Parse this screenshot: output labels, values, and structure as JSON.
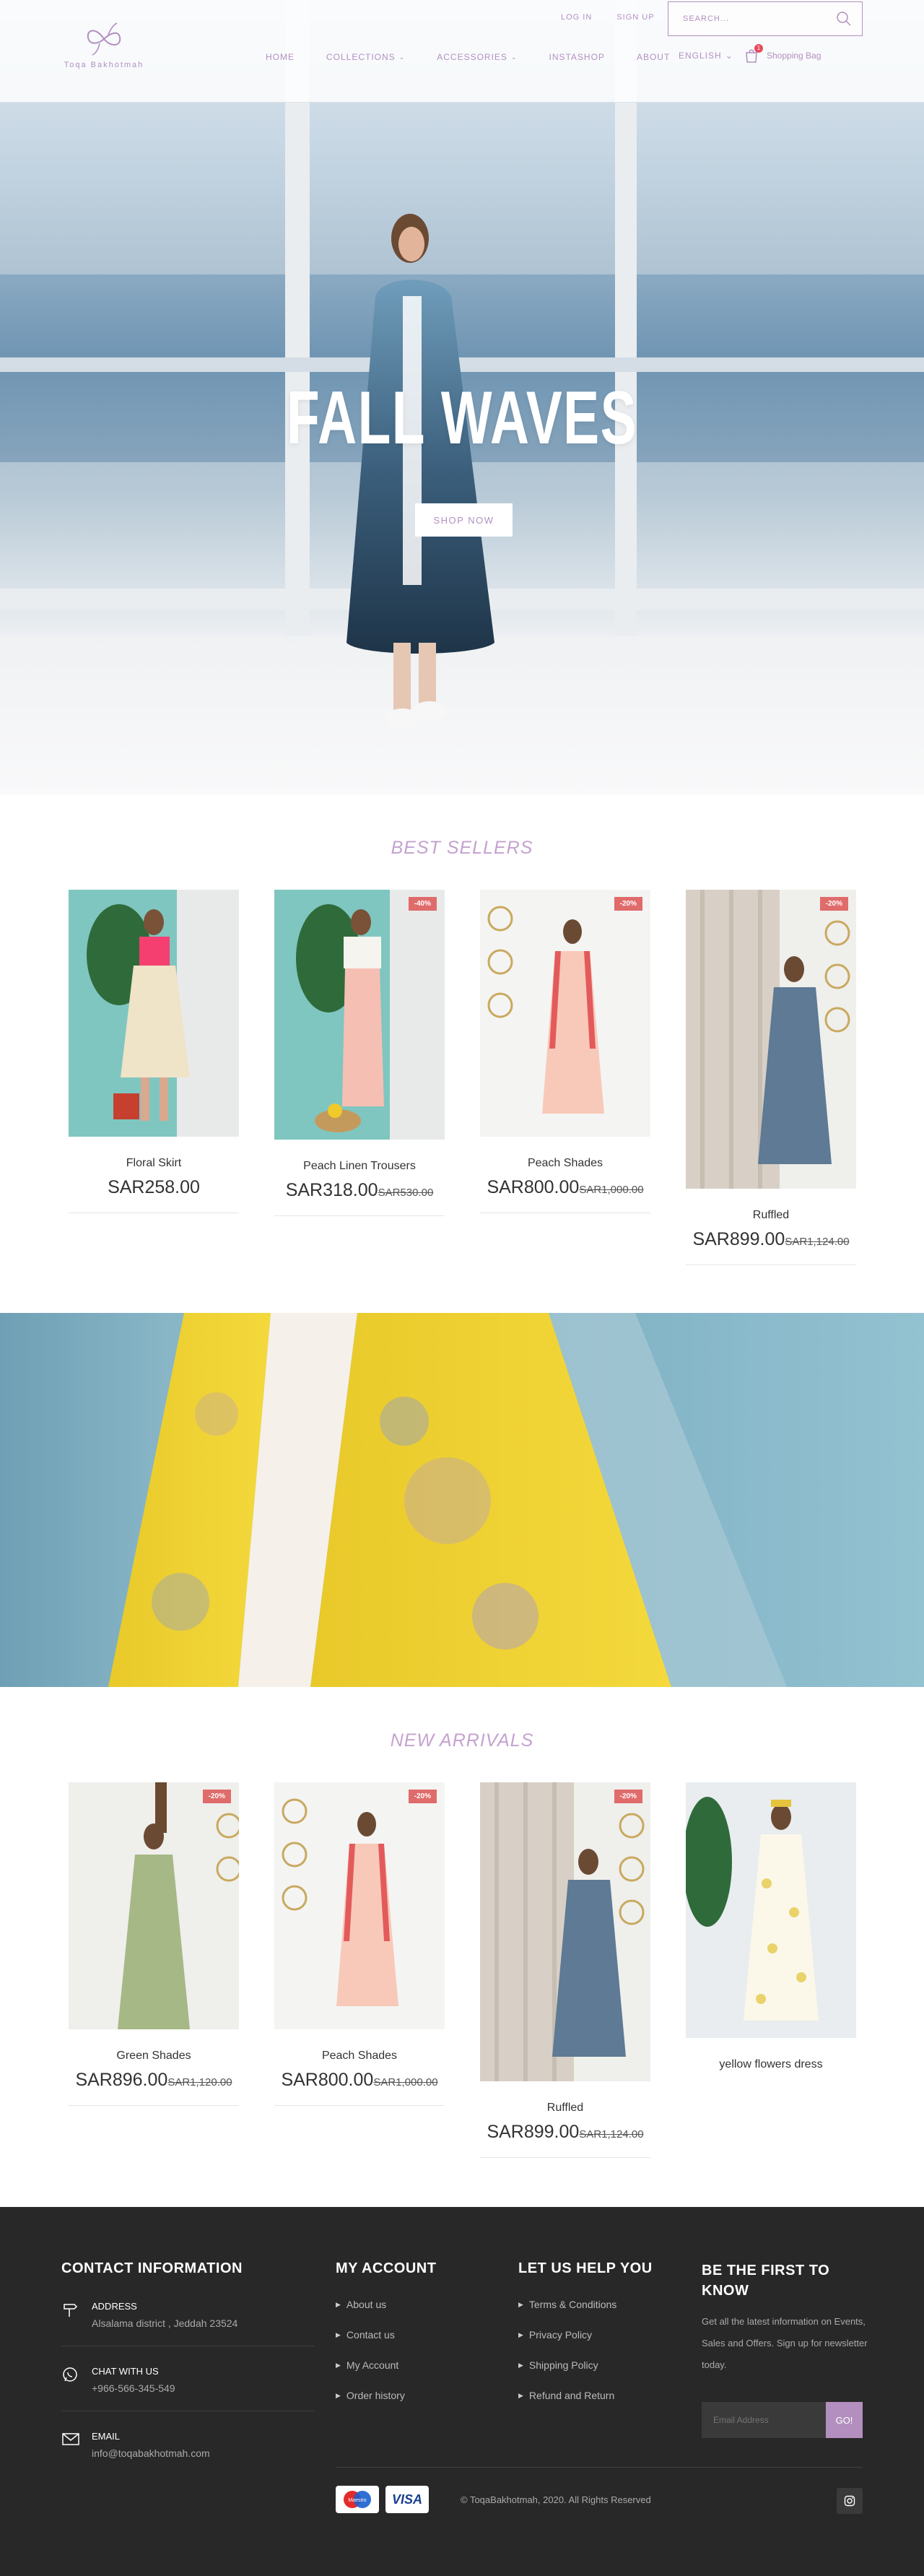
{
  "brand": {
    "name": "Toqa Bakhotmah",
    "accent": "#b38fbf",
    "sale_badge_color": "#e06b6b"
  },
  "header": {
    "login": "LOG IN",
    "signup": "SIGN UP",
    "search_placeholder": "SEARCH...",
    "nav": [
      {
        "label": "HOME",
        "dropdown": false
      },
      {
        "label": "COLLECTIONS",
        "dropdown": true
      },
      {
        "label": "ACCESSORIES",
        "dropdown": true
      },
      {
        "label": "INSTASHOP",
        "dropdown": false
      },
      {
        "label": "ABOUT",
        "dropdown": false
      }
    ],
    "language": "ENGLISH",
    "bag_label": "Shopping Bag",
    "bag_count": "1"
  },
  "hero": {
    "title": "FALL WAVES",
    "button": "SHOP NOW"
  },
  "best_sellers": {
    "title": "BEST SELLERS",
    "products": [
      {
        "name": "Floral Skirt",
        "price": "SAR258.00",
        "old_price": "",
        "badge": ""
      },
      {
        "name": "Peach Linen Trousers",
        "price": "SAR318.00",
        "old_price": "SAR530.00",
        "badge": "-40%"
      },
      {
        "name": "Peach Shades",
        "price": "SAR800.00",
        "old_price": "SAR1,000.00",
        "badge": "-20%"
      },
      {
        "name": "Ruffled",
        "price": "SAR899.00",
        "old_price": "SAR1,124.00",
        "badge": "-20%"
      }
    ]
  },
  "new_arrivals": {
    "title": "NEW ARRIVALS",
    "products": [
      {
        "name": "Green Shades",
        "price": "SAR896.00",
        "old_price": "SAR1,120.00",
        "badge": "-20%"
      },
      {
        "name": "Peach Shades",
        "price": "SAR800.00",
        "old_price": "SAR1,000.00",
        "badge": "-20%"
      },
      {
        "name": "Ruffled",
        "price": "SAR899.00",
        "old_price": "SAR1,124.00",
        "badge": "-20%"
      },
      {
        "name": "yellow flowers dress",
        "price": "",
        "old_price": "",
        "badge": ""
      }
    ]
  },
  "footer": {
    "contact_title": "CONTACT INFORMATION",
    "address_label": "ADDRESS",
    "address_value": "Alsalama district , Jeddah 23524",
    "chat_label": "CHAT WITH US",
    "chat_value": "+966-566-345-549",
    "email_label": "EMAIL",
    "email_value": "info@toqabakhotmah.com",
    "account_title": "MY ACCOUNT",
    "account_links": [
      "About us",
      "Contact us",
      "My Account",
      "Order history"
    ],
    "help_title": "LET US HELP YOU",
    "help_links": [
      "Terms & Conditions",
      "Privacy Policy",
      "Shipping Policy",
      "Refund and Return"
    ],
    "newsletter_title_line1": "BE THE FIRST TO",
    "newsletter_title_line2": "KNOW",
    "newsletter_text": "Get all the latest information on Events, Sales and Offers. Sign up for newsletter today.",
    "email_placeholder": "Email Address",
    "go_button": "GO!",
    "payments": [
      "Maestro",
      "VISA"
    ],
    "copyright": "© ToqaBakhotmah, 2020. All Rights Reserved"
  }
}
